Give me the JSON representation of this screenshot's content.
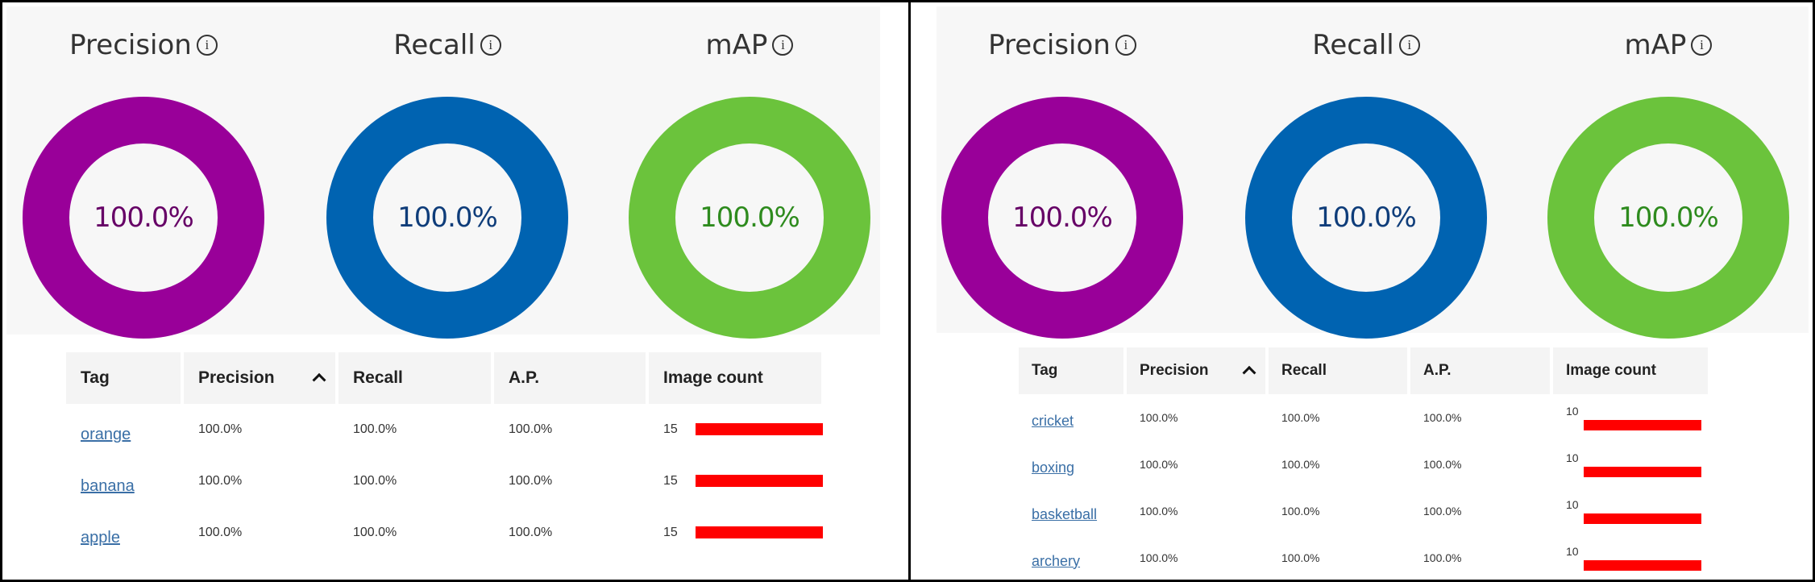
{
  "colors": {
    "precision_ring": "#990099",
    "precision_text": "#660066",
    "recall_ring": "#0063b1",
    "recall_text": "#0f3d7a",
    "map_ring": "#6bc33c",
    "map_text": "#2e8b1e",
    "bar": "#ff0000",
    "link": "#3a6fa6"
  },
  "icons": {
    "info": "info-icon",
    "sort": "sort-ascending-caret-icon"
  },
  "panels": [
    {
      "metrics": [
        {
          "title": "Precision",
          "info_glyph": "i",
          "value": "100.0%",
          "fraction": 1.0
        },
        {
          "title": "Recall",
          "info_glyph": "i",
          "value": "100.0%",
          "fraction": 1.0
        },
        {
          "title": "mAP",
          "info_glyph": "i",
          "value": "100.0%",
          "fraction": 1.0
        }
      ],
      "table": {
        "headers": [
          "Tag",
          "Precision",
          "Recall",
          "A.P.",
          "Image count"
        ],
        "rows": [
          {
            "tag": "orange",
            "precision": "100.0%",
            "recall": "100.0%",
            "ap": "100.0%",
            "count": "15",
            "bar_fraction": 1.0
          },
          {
            "tag": "banana",
            "precision": "100.0%",
            "recall": "100.0%",
            "ap": "100.0%",
            "count": "15",
            "bar_fraction": 1.0
          },
          {
            "tag": "apple",
            "precision": "100.0%",
            "recall": "100.0%",
            "ap": "100.0%",
            "count": "15",
            "bar_fraction": 1.0
          }
        ]
      }
    },
    {
      "metrics": [
        {
          "title": "Precision",
          "info_glyph": "i",
          "value": "100.0%",
          "fraction": 1.0
        },
        {
          "title": "Recall",
          "info_glyph": "i",
          "value": "100.0%",
          "fraction": 1.0
        },
        {
          "title": "mAP",
          "info_glyph": "i",
          "value": "100.0%",
          "fraction": 1.0
        }
      ],
      "table": {
        "headers": [
          "Tag",
          "Precision",
          "Recall",
          "A.P.",
          "Image count"
        ],
        "rows": [
          {
            "tag": "cricket",
            "precision": "100.0%",
            "recall": "100.0%",
            "ap": "100.0%",
            "count": "10",
            "bar_fraction": 1.0
          },
          {
            "tag": "boxing",
            "precision": "100.0%",
            "recall": "100.0%",
            "ap": "100.0%",
            "count": "10",
            "bar_fraction": 1.0
          },
          {
            "tag": "basketball",
            "precision": "100.0%",
            "recall": "100.0%",
            "ap": "100.0%",
            "count": "10",
            "bar_fraction": 1.0
          },
          {
            "tag": "archery",
            "precision": "100.0%",
            "recall": "100.0%",
            "ap": "100.0%",
            "count": "10",
            "bar_fraction": 1.0
          }
        ]
      }
    }
  ]
}
